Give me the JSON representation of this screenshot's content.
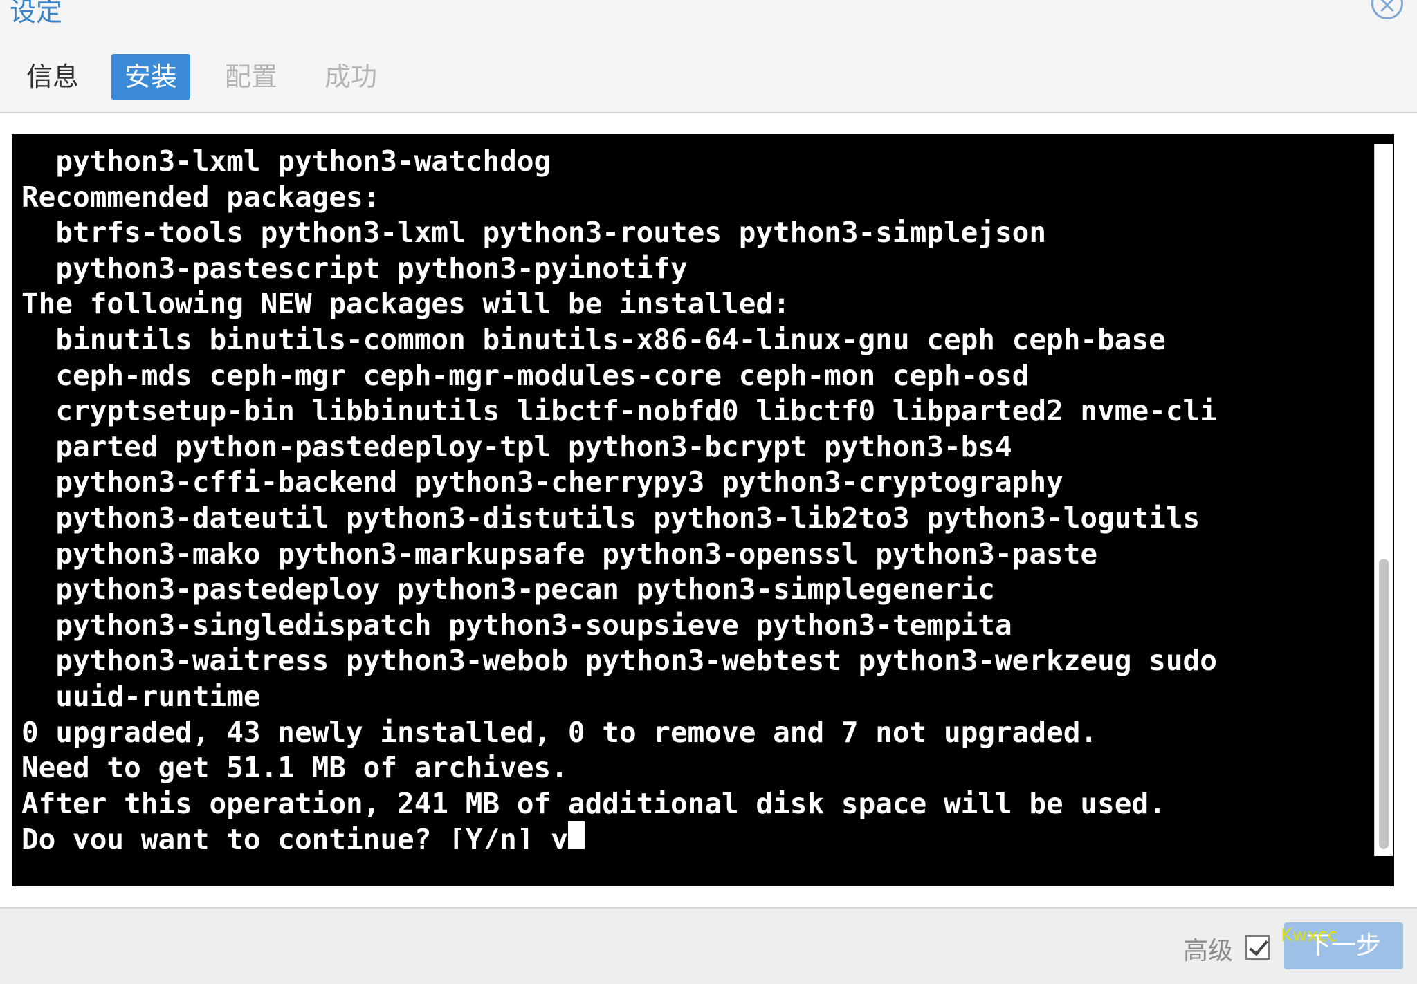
{
  "window": {
    "title": "设定",
    "close_symbol": "×"
  },
  "tabs": [
    {
      "label": "信息",
      "state": "visited"
    },
    {
      "label": "安装",
      "state": "active"
    },
    {
      "label": "配置",
      "state": "disabled"
    },
    {
      "label": "成功",
      "state": "disabled"
    }
  ],
  "terminal": {
    "lines": [
      "  python3-lxml python3-watchdog",
      "Recommended packages:",
      "  btrfs-tools python3-lxml python3-routes python3-simplejson",
      "  python3-pastescript python3-pyinotify",
      "The following NEW packages will be installed:",
      "  binutils binutils-common binutils-x86-64-linux-gnu ceph ceph-base",
      "  ceph-mds ceph-mgr ceph-mgr-modules-core ceph-mon ceph-osd",
      "  cryptsetup-bin libbinutils libctf-nobfd0 libctf0 libparted2 nvme-cli",
      "  parted python-pastedeploy-tpl python3-bcrypt python3-bs4",
      "  python3-cffi-backend python3-cherrypy3 python3-cryptography",
      "  python3-dateutil python3-distutils python3-lib2to3 python3-logutils",
      "  python3-mako python3-markupsafe python3-openssl python3-paste",
      "  python3-pastedeploy python3-pecan python3-simplegeneric",
      "  python3-singledispatch python3-soupsieve python3-tempita",
      "  python3-waitress python3-webob python3-webtest python3-werkzeug sudo",
      "  uuid-runtime",
      "0 upgraded, 43 newly installed, 0 to remove and 7 not upgraded.",
      "Need to get 51.1 MB of archives.",
      "After this operation, 241 MB of additional disk space will be used.",
      "Do you want to continue? [Y/n] y"
    ]
  },
  "footer": {
    "advanced_label": "高级",
    "advanced_checked": true,
    "next_label": "下一步",
    "watermark": "Kwxcc"
  },
  "colors": {
    "accent": "#3b8ad8",
    "title": "#3a84c7",
    "terminal_bg": "#000000",
    "terminal_fg": "#ffffff",
    "watermark": "#e6e200"
  }
}
